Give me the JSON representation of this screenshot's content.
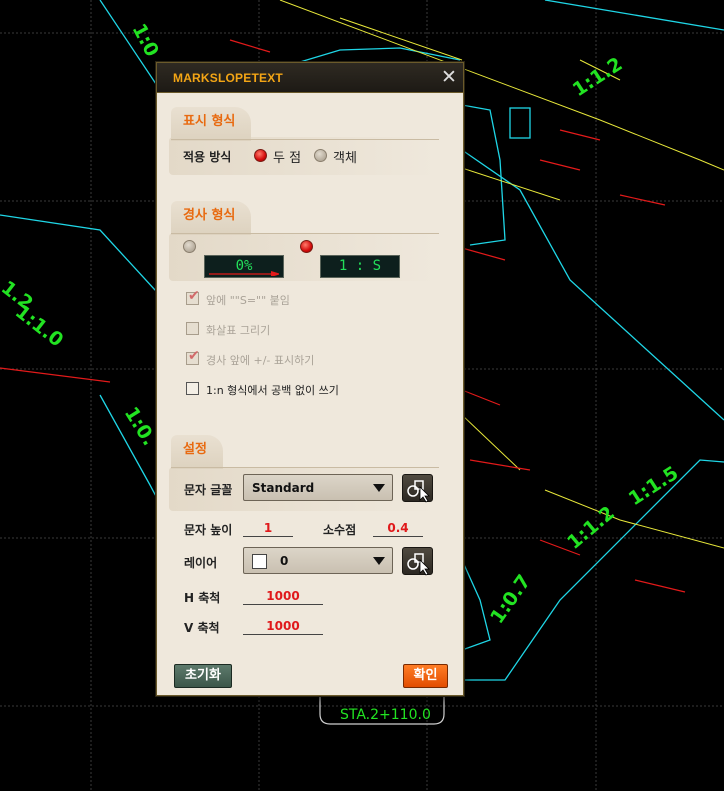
{
  "dialog": {
    "title": "MARKSLOPETEXT",
    "close_glyph": "✕"
  },
  "display_format": {
    "section_title": "표시 형식",
    "apply_label": "적용 방식",
    "option_two_points": "두 점",
    "option_object": "객체",
    "selected": "two_points"
  },
  "slope_format": {
    "section_title": "경사 형식",
    "percent_preview": "0%",
    "ratio_preview": "1 : S",
    "selected": "ratio",
    "checkboxes": [
      {
        "label": "앞에 \"\"S=\"\" 붙임",
        "checked": true,
        "enabled": false
      },
      {
        "label": "화살표 그리기",
        "checked": false,
        "enabled": false
      },
      {
        "label": "경사 앞에 +/- 표시하기",
        "checked": true,
        "enabled": false
      },
      {
        "label": "1:n 형식에서 공백 없이 쓰기",
        "checked": false,
        "enabled": true
      }
    ]
  },
  "settings": {
    "section_title": "설정",
    "font_label": "문자 글꼴",
    "font_value": "Standard",
    "height_label": "문자 높이",
    "height_value": "1",
    "decimal_label": "소수점",
    "decimal_value": "0.4",
    "layer_label": "레이어",
    "layer_value": "0",
    "h_scale_label": "H 축척",
    "h_scale_value": "1000",
    "v_scale_label": "V 축척",
    "v_scale_value": "1000"
  },
  "buttons": {
    "reset": "초기화",
    "ok": "확인"
  },
  "cad": {
    "labels": [
      "1:0",
      "1:1.2",
      "1.2",
      "1:1.0",
      "1:0.",
      "1:1.5",
      "1:1.2",
      "1:0.7"
    ],
    "station": "STA.2+110.0",
    "colors": {
      "green_text": "#22e322",
      "cyan": "#1fd6e6",
      "yellow": "#e8e83a",
      "red": "#e31a1a",
      "grid": "#3b3b3b"
    }
  }
}
